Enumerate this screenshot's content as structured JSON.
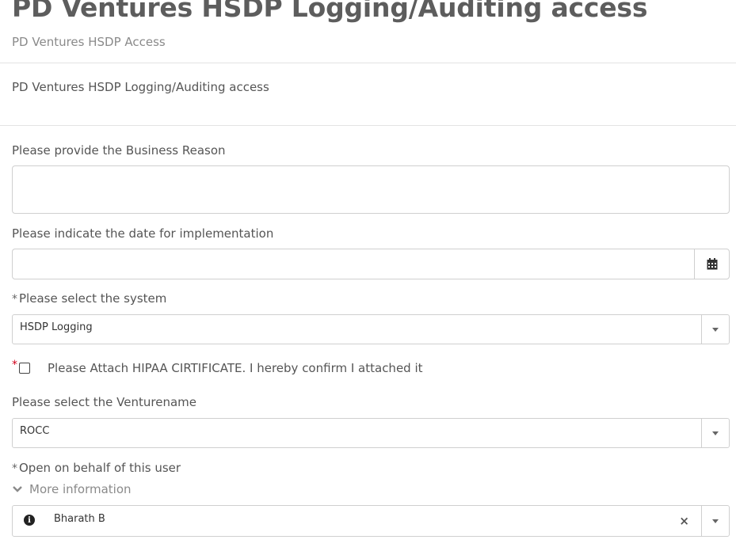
{
  "page": {
    "title": "PD Ventures HSDP Logging/Auditing access",
    "subtitle": "PD Ventures HSDP Access",
    "description": "PD Ventures HSDP Logging/Auditing access"
  },
  "form": {
    "business_reason": {
      "label": "Please provide the Business Reason",
      "value": ""
    },
    "implementation_date": {
      "label": "Please indicate the date for implementation",
      "value": "",
      "button_icon": "calendar-icon"
    },
    "system": {
      "required_marker": "*",
      "label": "Please select the system",
      "selected": "HSDP Logging"
    },
    "hipaa": {
      "required_marker": "*",
      "label": "Please Attach HIPAA CIRTIFICATE. I hereby confirm I attached it",
      "checked": false
    },
    "venturename": {
      "label": "Please select the Venturename",
      "selected": "ROCC"
    },
    "open_on_behalf": {
      "required_marker": "*",
      "label": "Open on behalf of this user",
      "more_info": "More information",
      "selected": "Bharath B",
      "clear_symbol": "×"
    }
  },
  "colors": {
    "required_red": "#d0021b",
    "border": "#cfcfcf",
    "title": "#5d5d5d"
  }
}
